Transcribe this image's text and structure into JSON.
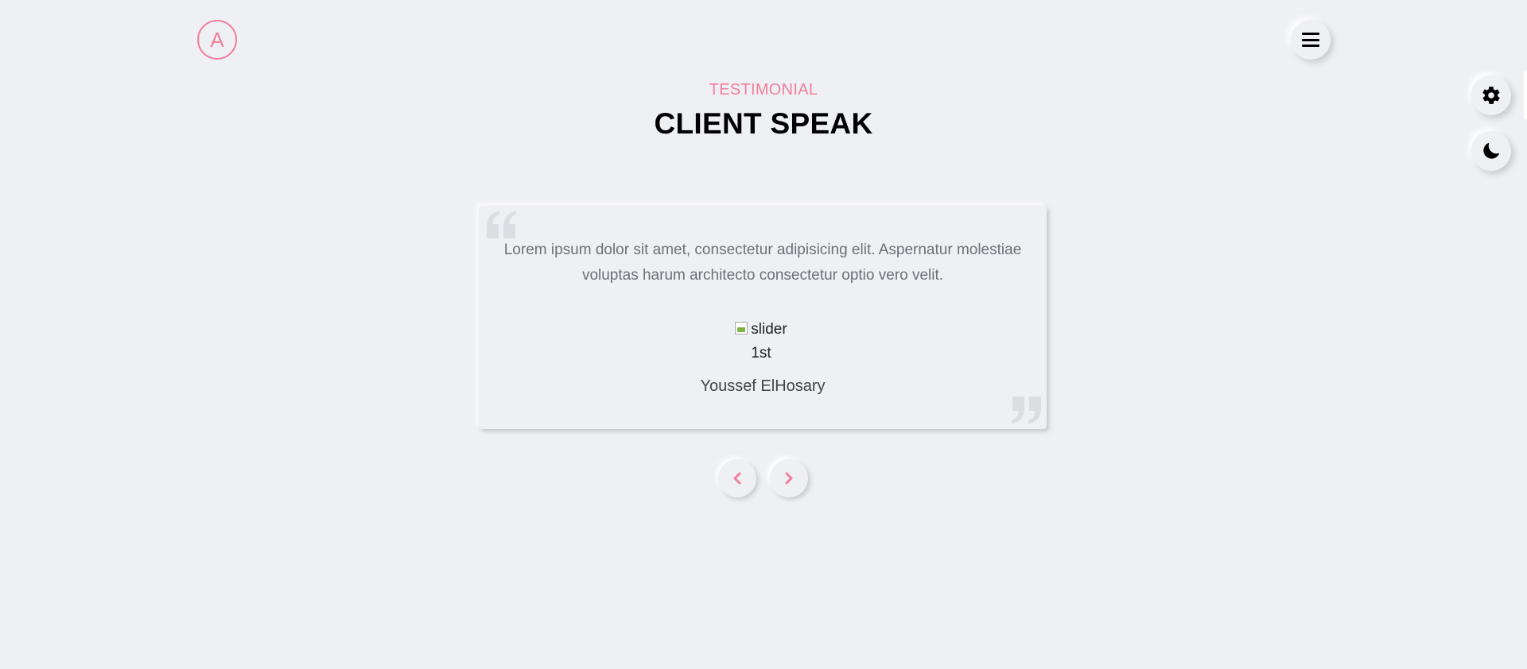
{
  "header": {
    "logo_letter": "A"
  },
  "icons": {
    "menu": "hamburger-icon",
    "settings": "gear-icon",
    "theme": "moon-icon",
    "prev": "chevron-left-icon",
    "next": "chevron-right-icon",
    "quote_open": "quote-open-icon",
    "quote_close": "quote-close-icon"
  },
  "section": {
    "subtitle": "TESTIMONIAL",
    "title": "CLIENT SPEAK"
  },
  "testimonial": {
    "text": "Lorem ipsum dolor sit amet, consectetur adipisicing elit. Aspernatur molestiae voluptas harum architecto consectetur optio vero velit.",
    "image_alt": "slider 1st",
    "image_alt_line1": "slider",
    "image_alt_line2": "1st",
    "client_name": "Youssef ElHosary"
  },
  "colors": {
    "accent": "#f07e9b",
    "background": "#eff0f4",
    "text_muted": "#6f6f78"
  }
}
